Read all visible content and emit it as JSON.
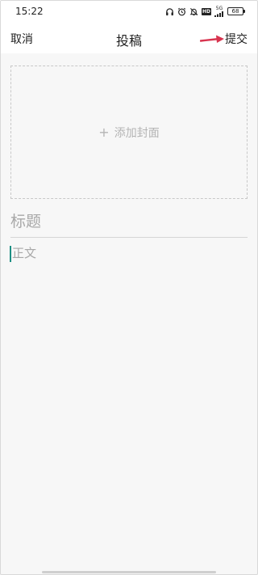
{
  "status_bar": {
    "time": "15:22",
    "icons": [
      "headphones-icon",
      "alarm-icon",
      "bell-off-icon",
      "hd-icon",
      "cellular-icon",
      "battery-icon"
    ],
    "hd_label": "HD",
    "network_label": "5G",
    "battery_level": "68"
  },
  "nav": {
    "cancel_label": "取消",
    "title": "投稿",
    "submit_label": "提交"
  },
  "editor": {
    "cover_label": "添加封面",
    "cover_icon": "plus-icon",
    "title_placeholder": "标题",
    "body_placeholder": "正文"
  },
  "colors": {
    "annotation_arrow": "#d8344f",
    "cursor": "#1d8f83",
    "content_background": "#f7f7f7"
  }
}
